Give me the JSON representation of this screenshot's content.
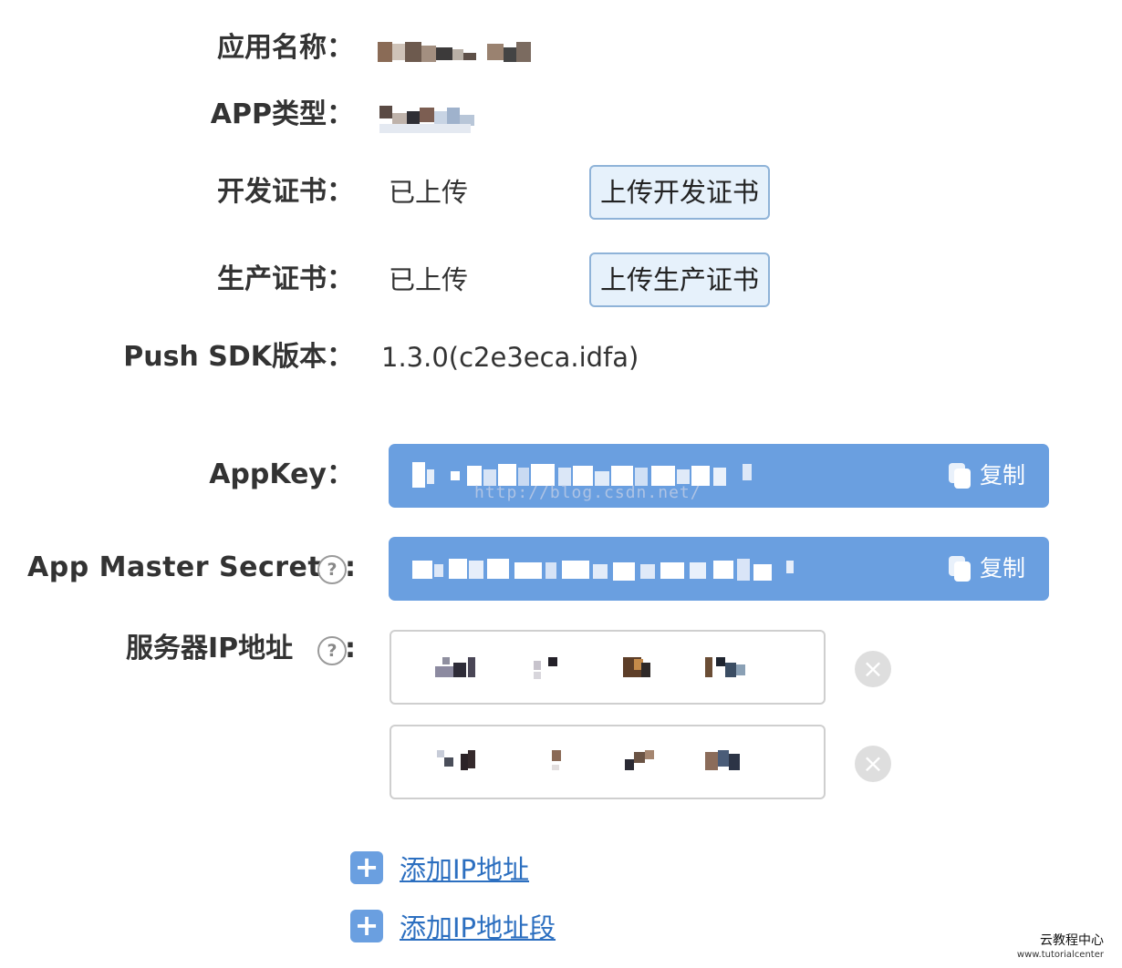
{
  "labels": {
    "app_name": "应用名称：",
    "app_type": "APP类型：",
    "dev_cert": "开发证书：",
    "prod_cert": "生产证书：",
    "sdk_version": "Push SDK版本：",
    "appkey": "AppKey：",
    "master_secret": "App Master Secret",
    "server_ip": "服务器IP地址",
    "colon": ":"
  },
  "values": {
    "dev_cert_status": "已上传",
    "prod_cert_status": "已上传",
    "sdk_version": "1.3.0(c2e3eca.idfa)"
  },
  "buttons": {
    "upload_dev_cert": "上传开发证书",
    "upload_prod_cert": "上传生产证书",
    "copy": "复制"
  },
  "help_icon_text": "?",
  "remove_icon_text": "×",
  "add_icon_text": "+",
  "links": {
    "add_ip": "添加IP地址",
    "add_ip_range": "添加IP地址段"
  },
  "watermark": "http://blog.csdn.net/",
  "footer": {
    "brand": "云教程中心",
    "sub": "www.tutorialcenter"
  },
  "colors": {
    "accent": "#6a9fe0",
    "link": "#2c6fc0",
    "button_bg": "#e6f1fb",
    "button_border": "#8fb3d8"
  },
  "icons": {
    "copy": "copy-icon",
    "help": "question-circle-icon",
    "remove": "close-circle-icon",
    "add": "plus-square-icon"
  }
}
